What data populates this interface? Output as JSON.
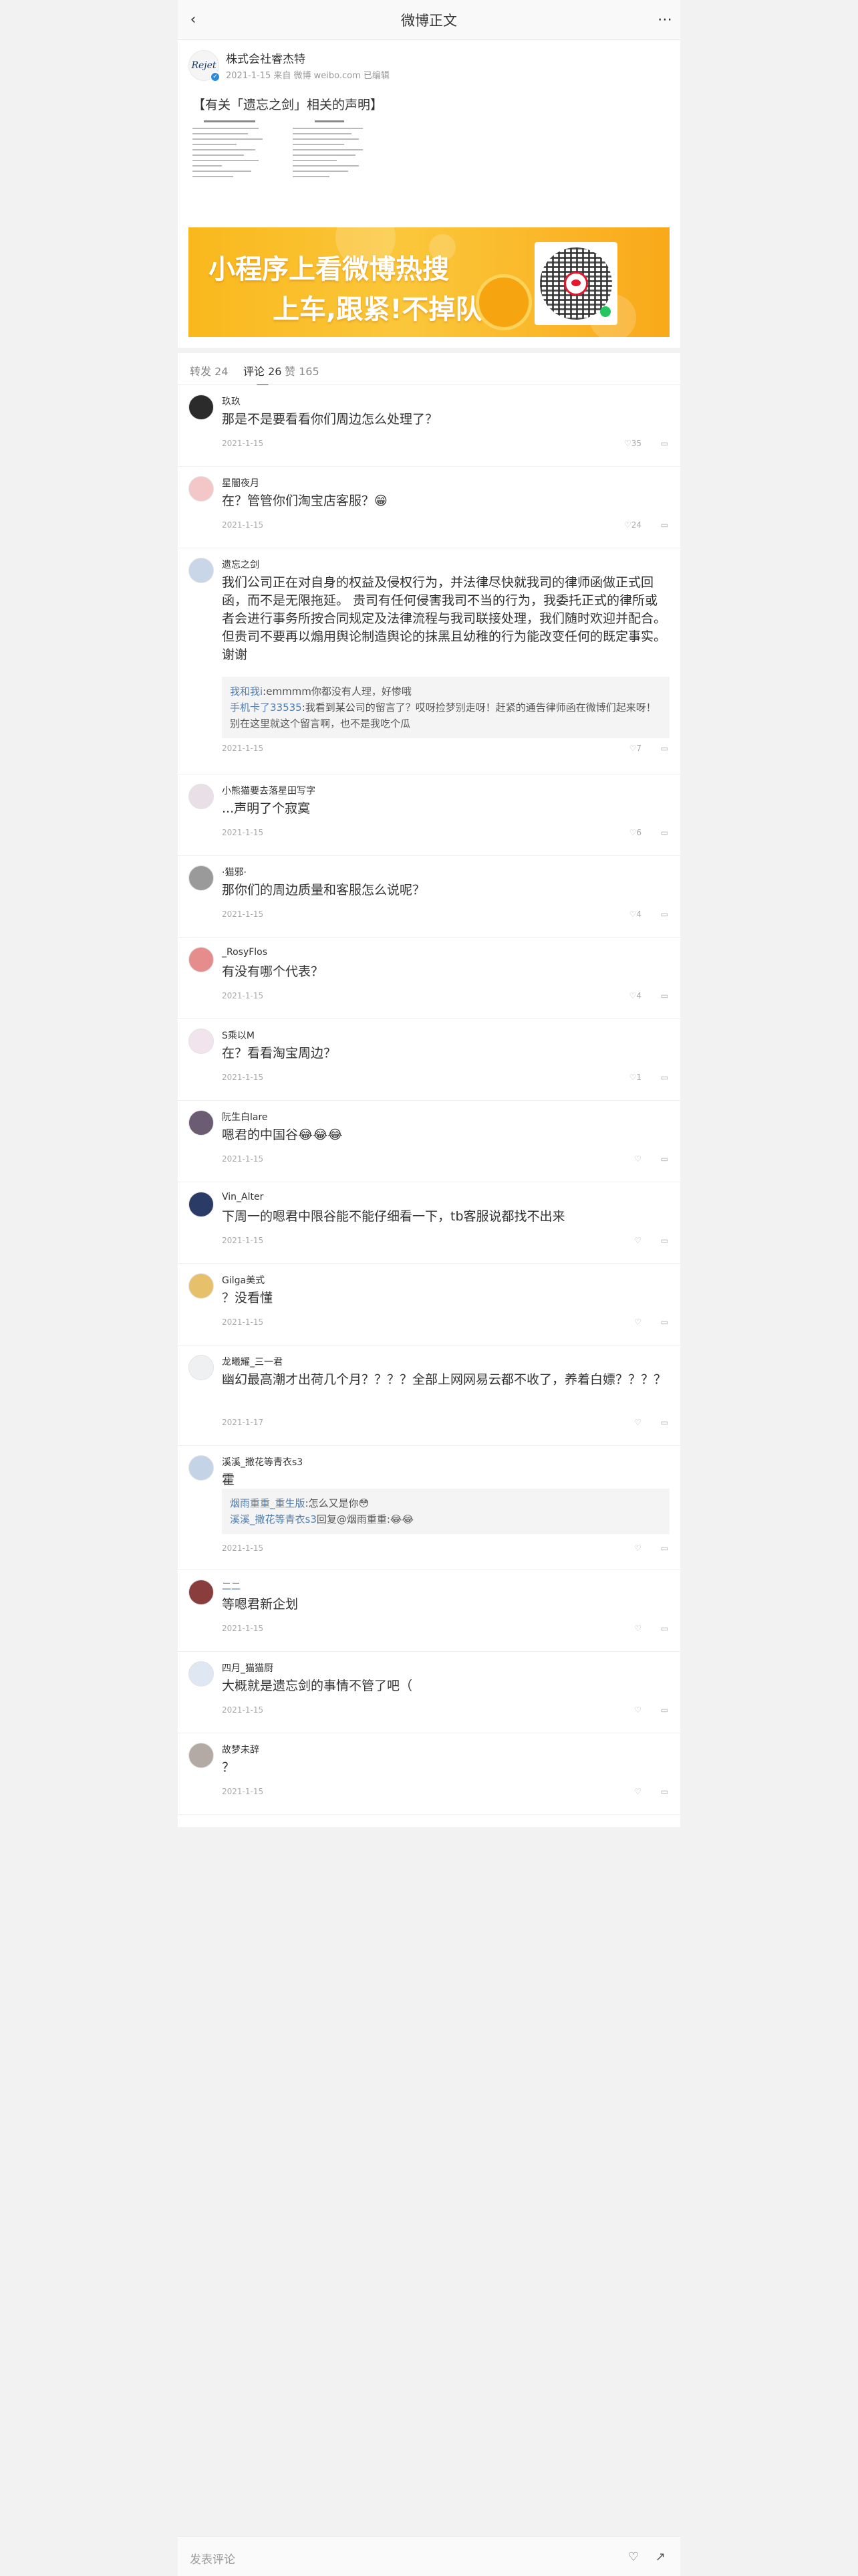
{
  "header": {
    "title": "微博正文",
    "back_icon": "arrow-left-icon",
    "more_icon": "more-icon"
  },
  "post": {
    "author": "株式会社睿杰特",
    "avatar_logo": "Rejet",
    "meta": "2021-1-15 来自 微博 weibo.com 已编辑",
    "text": "【有关「遗忘之剑」相关的声明】",
    "banner": {
      "line1": "小程序上看微博热搜",
      "line2": "上车,跟紧!不掉队!"
    }
  },
  "tabs": [
    {
      "label": "转发 24"
    },
    {
      "label": "评论 26"
    },
    {
      "label": "赞 165"
    }
  ],
  "comments": [
    {
      "name": "玖玖",
      "text": "那是不是要看看你们周边怎么处理了？",
      "time": "2021-1-15",
      "likes": "35",
      "avatar": "#2b2b2b"
    },
    {
      "name": "星闇夜月",
      "text": "在？管管你们淘宝店客服？😁",
      "time": "2021-1-15",
      "likes": "24",
      "avatar": "#f3c7c7"
    },
    {
      "name": "遗忘之剑",
      "text": "我们公司正在对自身的权益及侵权行为，并法律尽快就我司的律师函做正式回函，而不是无限拖延。 贵司有任何侵害我司不当的行为，我委托正式的律所或者会进行事务所按合同规定及法律流程与我司联接处理，我们随时欢迎并配合。但贵司不要再以煽用舆论制造舆论的抹黑且幼稚的行为能改变任何的既定事实。 谢谢",
      "time": "2021-1-15",
      "likes": "7",
      "avatar": "#c9d6e8",
      "replies": [
        {
          "user": "我和我i",
          "text": ":emmmm你都没有人理，好惨哦"
        },
        {
          "user": "手机卡了33535",
          "text": ":我看到某公司的留言了？哎呀捡梦别走呀！赶紧的通告律师函在微博们起来呀！别在这里就这个留言啊，也不是我吃个瓜"
        }
      ]
    },
    {
      "name": "小熊猫要去落星田写字",
      "text": "...声明了个寂寞",
      "time": "2021-1-15",
      "likes": "6",
      "avatar": "#e9dfe6"
    },
    {
      "name": "·猫邪·",
      "text": "那你们的周边质量和客服怎么说呢？",
      "time": "2021-1-15",
      "likes": "4",
      "avatar": "#9a9a9a"
    },
    {
      "name": "_RosyFlos",
      "text": "有没有哪个代表？",
      "time": "2021-1-15",
      "likes": "4",
      "avatar": "#e58d8d"
    },
    {
      "name": "S乘以M",
      "text": "在？看看淘宝周边？",
      "time": "2021-1-15",
      "likes": "1",
      "avatar": "#f1e4ec"
    },
    {
      "name": "阮生白lare",
      "text": "嗯君的中国谷😂😂😂",
      "time": "2021-1-15",
      "likes": "",
      "avatar": "#6b5c74"
    },
    {
      "name": "Vin_Alter",
      "text": "下周一的嗯君中限谷能不能仔细看一下，tb客服说都找不出来",
      "time": "2021-1-15",
      "likes": "",
      "avatar": "#2a3b66"
    },
    {
      "name": "Gilga美式",
      "text": "？没看懂",
      "time": "2021-1-15",
      "likes": "",
      "avatar": "#e6c06a"
    },
    {
      "name": "龙曦耀_三一君",
      "text": "幽幻最高潮才出荷几个月？？？？全部上网网易云都不收了，养着白嫖？？？？",
      "time": "2021-1-17",
      "likes": "",
      "avatar": "#eef0f2"
    },
    {
      "name": "溪溪_撒花等青衣s3",
      "text": "霍",
      "time": "2021-1-15",
      "likes": "",
      "avatar": "#c5d3e6",
      "replies": [
        {
          "user": "烟雨重重_重生版",
          "text": ":怎么又是你😳"
        },
        {
          "user": "溪溪_撒花等青衣s3",
          "text": "回复@烟雨重重:😂😂"
        }
      ]
    },
    {
      "name": "二二",
      "text": "等嗯君新企划",
      "time": "2021-1-15",
      "likes": "",
      "avatar": "#8a3d3d",
      "name_blue": true
    },
    {
      "name": "四月_猫猫厨",
      "text": "大概就是遗忘剑的事情不管了吧（",
      "time": "2021-1-15",
      "likes": "",
      "avatar": "#dfe7f3"
    },
    {
      "name": "故梦未辞",
      "text": "？",
      "time": "2021-1-15",
      "likes": "",
      "avatar": "#b3aaa5"
    }
  ],
  "footer": {
    "input_hint": "发表评论",
    "icons": [
      "like-icon",
      "share-icon"
    ]
  }
}
